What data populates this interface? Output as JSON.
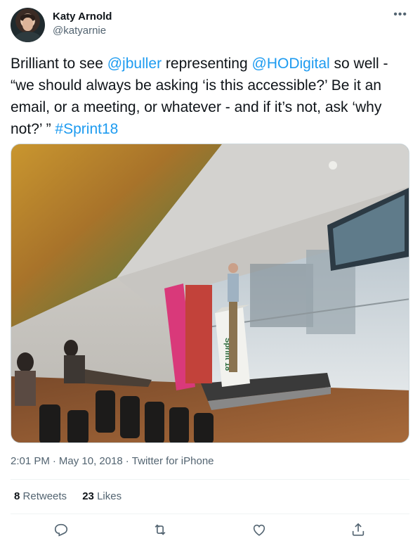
{
  "author": {
    "name": "Katy Arnold",
    "handle": "@katyarnie",
    "avatar_icon": "avatar-photo"
  },
  "tweet": {
    "segments": [
      {
        "text": "Brilliant to see ",
        "type": "text"
      },
      {
        "text": "@jbuller",
        "type": "mention"
      },
      {
        "text": " representing ",
        "type": "text"
      },
      {
        "text": "@HODigital",
        "type": "mention"
      },
      {
        "text": " so well - “we should always be asking ‘is this accessible?’ Be it an email, or a meeting, or whatever - and if it’s not, ask ‘why not?’ ”  ",
        "type": "text"
      },
      {
        "text": "#Sprint18",
        "type": "hashtag"
      }
    ],
    "media": {
      "description_icon": "conference-photo",
      "podium_text": "Sprint 18"
    }
  },
  "meta": {
    "time": "2:01 PM",
    "date": "May 10, 2018",
    "source": "Twitter for iPhone"
  },
  "stats": {
    "retweets_count": "8",
    "retweets_label": "Retweets",
    "likes_count": "23",
    "likes_label": "Likes"
  },
  "actions": [
    "reply-icon",
    "retweet-icon",
    "like-icon",
    "share-icon"
  ],
  "colors": {
    "link": "#1d9bf0",
    "secondary_text": "#536471",
    "primary_text": "#0f1419"
  }
}
